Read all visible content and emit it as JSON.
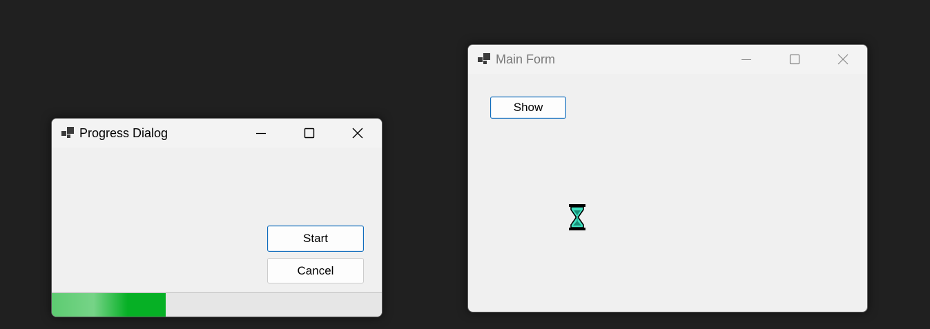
{
  "progress_dialog": {
    "title": "Progress Dialog",
    "icon": "app-icon",
    "start_label": "Start",
    "cancel_label": "Cancel",
    "progress_fraction": 0.345,
    "progress_color": "#06b025"
  },
  "main_form": {
    "title": "Main Form",
    "icon": "app-icon",
    "show_label": "Show",
    "cursor_icon": "hourglass-icon"
  },
  "colors": {
    "desktop": "#202020",
    "window_bg": "#f0f0f0",
    "focus_border": "#0f6cbd",
    "inactive_title": "#7a7a7a"
  }
}
